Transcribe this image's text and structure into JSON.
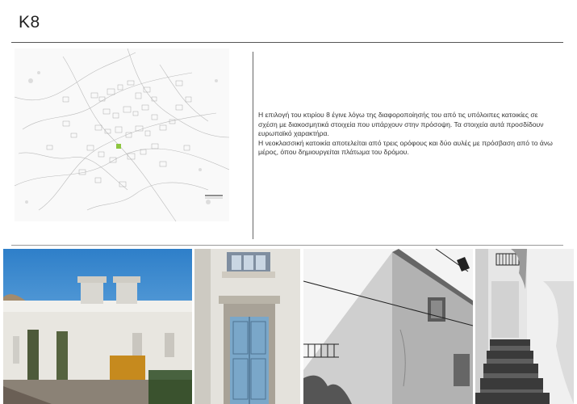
{
  "page": {
    "title": "K8",
    "description": [
      "Η επιλογή του κτιρίου 8 έγινε λόγω της διαφοροποίησής του από τις υπόλοιπες κατοικίες σε σχέση με διακοσμητικά στοιχεία που υπάρχουν στην πρόσοψη. Τα στοιχεία αυτά προσδίδουν ευρωπαϊκό χαρακτήρα.",
      "Η νεοκλασσική κατοικία αποτελείται από τρεις ορόφους και δύο αυλές με πρόσβαση από το άνω μέρος, όπου δημιουργείται πλάτωμα του δρόμου."
    ]
  },
  "map": {
    "highlight_color": "#8dc63f"
  },
  "photos": [
    {
      "name": "building-exterior-photo"
    },
    {
      "name": "door-window-photo"
    },
    {
      "name": "building-corner-photo"
    },
    {
      "name": "stairway-photo"
    }
  ]
}
